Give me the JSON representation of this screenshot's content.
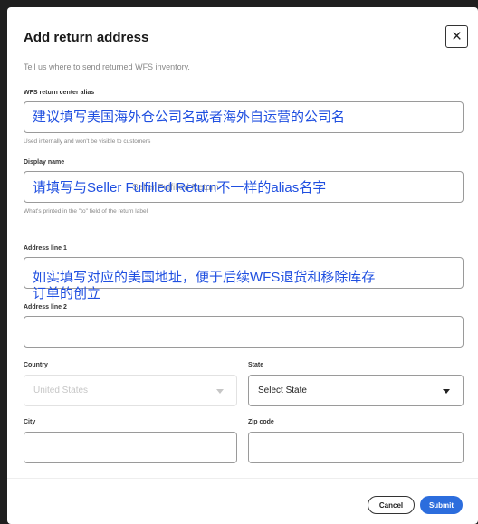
{
  "header": {
    "title": "Add return address",
    "close_label": "×"
  },
  "subtitle": "Tell us where to send returned WFS inventory.",
  "alias": {
    "label": "WFS return center alias",
    "overlay": "建议填写美国海外仓公司名或者海外自运营的公司名",
    "help": "Used internally and won't be visible to customers"
  },
  "display": {
    "label": "Display name",
    "overlay": "请填写与Seller Fulfilled Return不一样的alias名字",
    "underlying": "Seller Fulfilled Return",
    "help": "What's printed in the \"to\" field of the return label"
  },
  "address1": {
    "label": "Address line 1",
    "overlay_line1": "如实填写对应的美国地址，便于后续WFS退货和移除库存",
    "overlay_line2": "订单的创立"
  },
  "address2": {
    "label": "Address line 2"
  },
  "country": {
    "label": "Country",
    "value": "United States"
  },
  "state": {
    "label": "State",
    "value": "Select State"
  },
  "city": {
    "label": "City"
  },
  "zip": {
    "label": "Zip code"
  },
  "footer": {
    "cancel": "Cancel",
    "submit": "Submit"
  }
}
